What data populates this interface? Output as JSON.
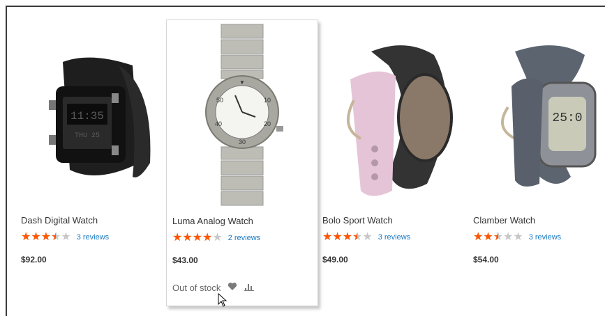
{
  "products": [
    {
      "name": "Dash Digital Watch",
      "rating_percent": 70,
      "reviews": "3 reviews",
      "price": "$92.00",
      "image_icon": "digital-watch-image"
    },
    {
      "name": "Luma Analog Watch",
      "rating_percent": 80,
      "reviews": "2 reviews",
      "price": "$43.00",
      "image_icon": "analog-watch-image",
      "stock_label": "Out of stock",
      "actions": [
        "wishlist-heart-icon",
        "compare-bars-icon"
      ]
    },
    {
      "name": "Bolo Sport Watch",
      "rating_percent": 70,
      "reviews": "3 reviews",
      "price": "$49.00",
      "image_icon": "sport-watch-image"
    },
    {
      "name": "Clamber Watch",
      "rating_percent": 50,
      "reviews": "3 reviews",
      "price": "$54.00",
      "image_icon": "clamber-watch-image"
    }
  ],
  "colors": {
    "star": "#ff5501",
    "star_empty": "#c7c7c7",
    "link": "#1979c3",
    "text": "#333333"
  }
}
